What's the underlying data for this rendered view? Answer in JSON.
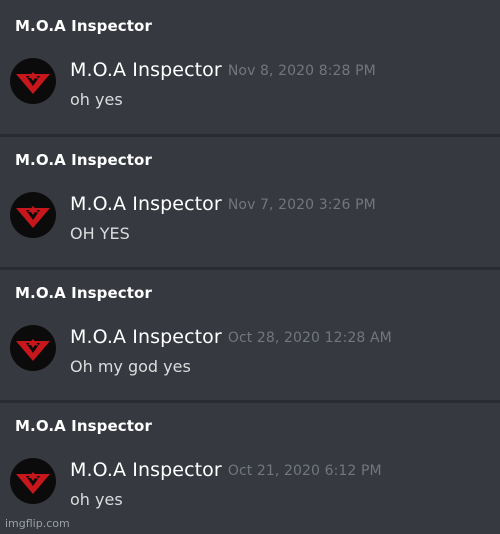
{
  "messages": [
    {
      "header": "M.O.A Inspector",
      "author": "M.O.A Inspector",
      "timestamp": "Nov 8, 2020 8:28 PM",
      "text": "oh yes"
    },
    {
      "header": "M.O.A Inspector",
      "author": "M.O.A Inspector",
      "timestamp": "Nov 7, 2020 3:26 PM",
      "text": "OH YES"
    },
    {
      "header": "M.O.A Inspector",
      "author": "M.O.A Inspector",
      "timestamp": "Oct 28, 2020 12:28 AM",
      "text": "Oh my god yes"
    },
    {
      "header": "M.O.A Inspector",
      "author": "M.O.A Inspector",
      "timestamp": "Oct 21, 2020 6:12 PM",
      "text": "oh yes"
    }
  ],
  "watermark": "imgflip.com",
  "colors": {
    "background": "#36393f",
    "divider": "#2a2c31",
    "author": "#ffffff",
    "timestamp": "#72767d",
    "message": "#dcddde",
    "avatar_emblem": "#c8161d"
  },
  "avatar_icon": "arstotzka-eagle-emblem-icon"
}
